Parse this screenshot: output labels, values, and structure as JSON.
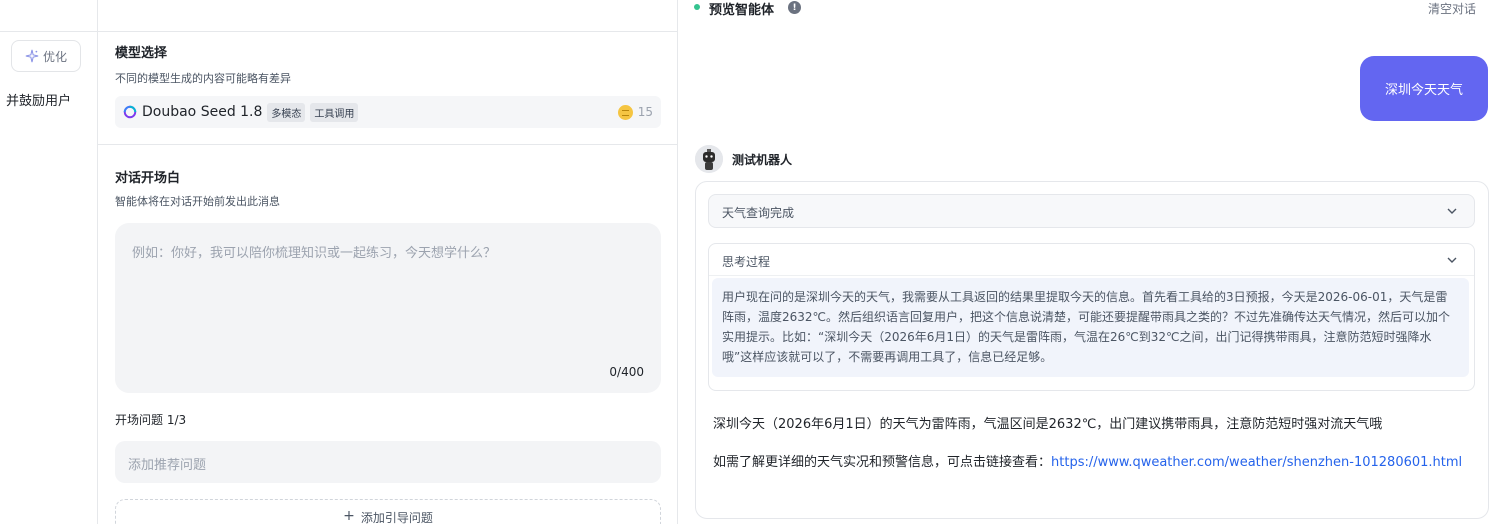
{
  "left": {
    "optimize_label": "优化",
    "partial_text": "并鼓励用户"
  },
  "model": {
    "section_title": "模型选择",
    "section_desc": "不同的模型生成的内容可能略有差异",
    "name": "Doubao Seed 1.8",
    "tags": [
      "多模态",
      "工具调用"
    ],
    "cost": "15"
  },
  "opening": {
    "section_title": "对话开场白",
    "section_desc": "智能体将在对话开始前发出此消息",
    "placeholder": "例如：你好，我可以陪你梳理知识或一起练习，今天想学什么？",
    "counter": "0/400",
    "questions_label": "开场问题 1/3",
    "question_placeholder": "添加推荐问题",
    "add_guide_label": "添加引导问题"
  },
  "preview": {
    "title": "预览智能体",
    "clear_label": "清空对话",
    "user_message": "深圳今天天气",
    "bot_name": "测试机器人",
    "tool_status": "天气查询完成",
    "thinking_label": "思考过程",
    "thinking_text": "用户现在问的是深圳今天的天气，我需要从工具返回的结果里提取今天的信息。首先看工具给的3日预报，今天是2026-06-01，天气是雷阵雨，温度2632℃。然后组织语言回复用户，把这个信息说清楚，可能还要提醒带雨具之类的？不过先准确传达天气情况，然后可以加个实用提示。比如：“深圳今天（2026年6月1日）的天气是雷阵雨，气温在26℃到32℃之间，出门记得携带雨具，注意防范短时强降水哦”这样应该就可以了，不需要再调用工具了，信息已经足够。",
    "answer_line1": "深圳今天（2026年6月1日）的天气为雷阵雨，气温区间是2632℃，出门建议携带雨具，注意防范短时强对流天气哦",
    "answer_line2_prefix": "如需了解更详细的天气实况和预警信息，可点击链接查看：",
    "answer_link": "https://www.qweather.com/weather/shenzhen-101280601.html"
  },
  "colors": {
    "accent": "#6366f1",
    "link": "#2563eb",
    "status_dot": "#34c38f"
  }
}
